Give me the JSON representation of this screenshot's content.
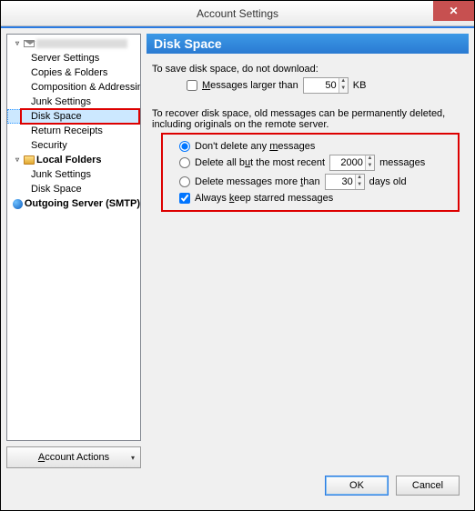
{
  "window": {
    "title": "Account Settings",
    "close_glyph": "✕"
  },
  "sidebar": {
    "items": [
      {
        "label": "",
        "level": 1,
        "icon": "mail-icon",
        "twisty": "▿",
        "bold": true,
        "redacted": true
      },
      {
        "label": "Server Settings",
        "level": 2
      },
      {
        "label": "Copies & Folders",
        "level": 2
      },
      {
        "label": "Composition & Addressing",
        "level": 2
      },
      {
        "label": "Junk Settings",
        "level": 2
      },
      {
        "label": "Disk Space",
        "level": 2,
        "selected": true,
        "highlight": true
      },
      {
        "label": "Return Receipts",
        "level": 2
      },
      {
        "label": "Security",
        "level": 2
      },
      {
        "label": "Local Folders",
        "level": 1,
        "icon": "folder-icon",
        "twisty": "▿",
        "bold": true
      },
      {
        "label": "Junk Settings",
        "level": 2
      },
      {
        "label": "Disk Space",
        "level": 2
      },
      {
        "label": "Outgoing Server (SMTP)",
        "level": 1,
        "icon": "globe-icon",
        "bold": true
      }
    ],
    "account_actions_label": "Account Actions"
  },
  "panel": {
    "header": "Disk Space",
    "save_intro": "To save disk space, do not download:",
    "msg_larger_than": "Messages larger than",
    "msg_larger_value": "50",
    "kb_label": "KB",
    "recover_intro": "To recover disk space, old messages can be permanently deleted, including originals on the remote server.",
    "opt_dont_delete": "Don't delete any messages",
    "opt_delete_but_recent_pre": "Delete all but the most recent",
    "opt_delete_but_recent_value": "2000",
    "opt_delete_but_recent_post": "messages",
    "opt_delete_more_than_pre": "Delete messages more than",
    "opt_delete_more_than_value": "30",
    "opt_delete_more_than_post": "days old",
    "opt_always_keep_starred": "Always keep starred messages",
    "radio_selected": 0,
    "larger_checked": false,
    "starred_checked": true
  },
  "footer": {
    "ok": "OK",
    "cancel": "Cancel"
  }
}
